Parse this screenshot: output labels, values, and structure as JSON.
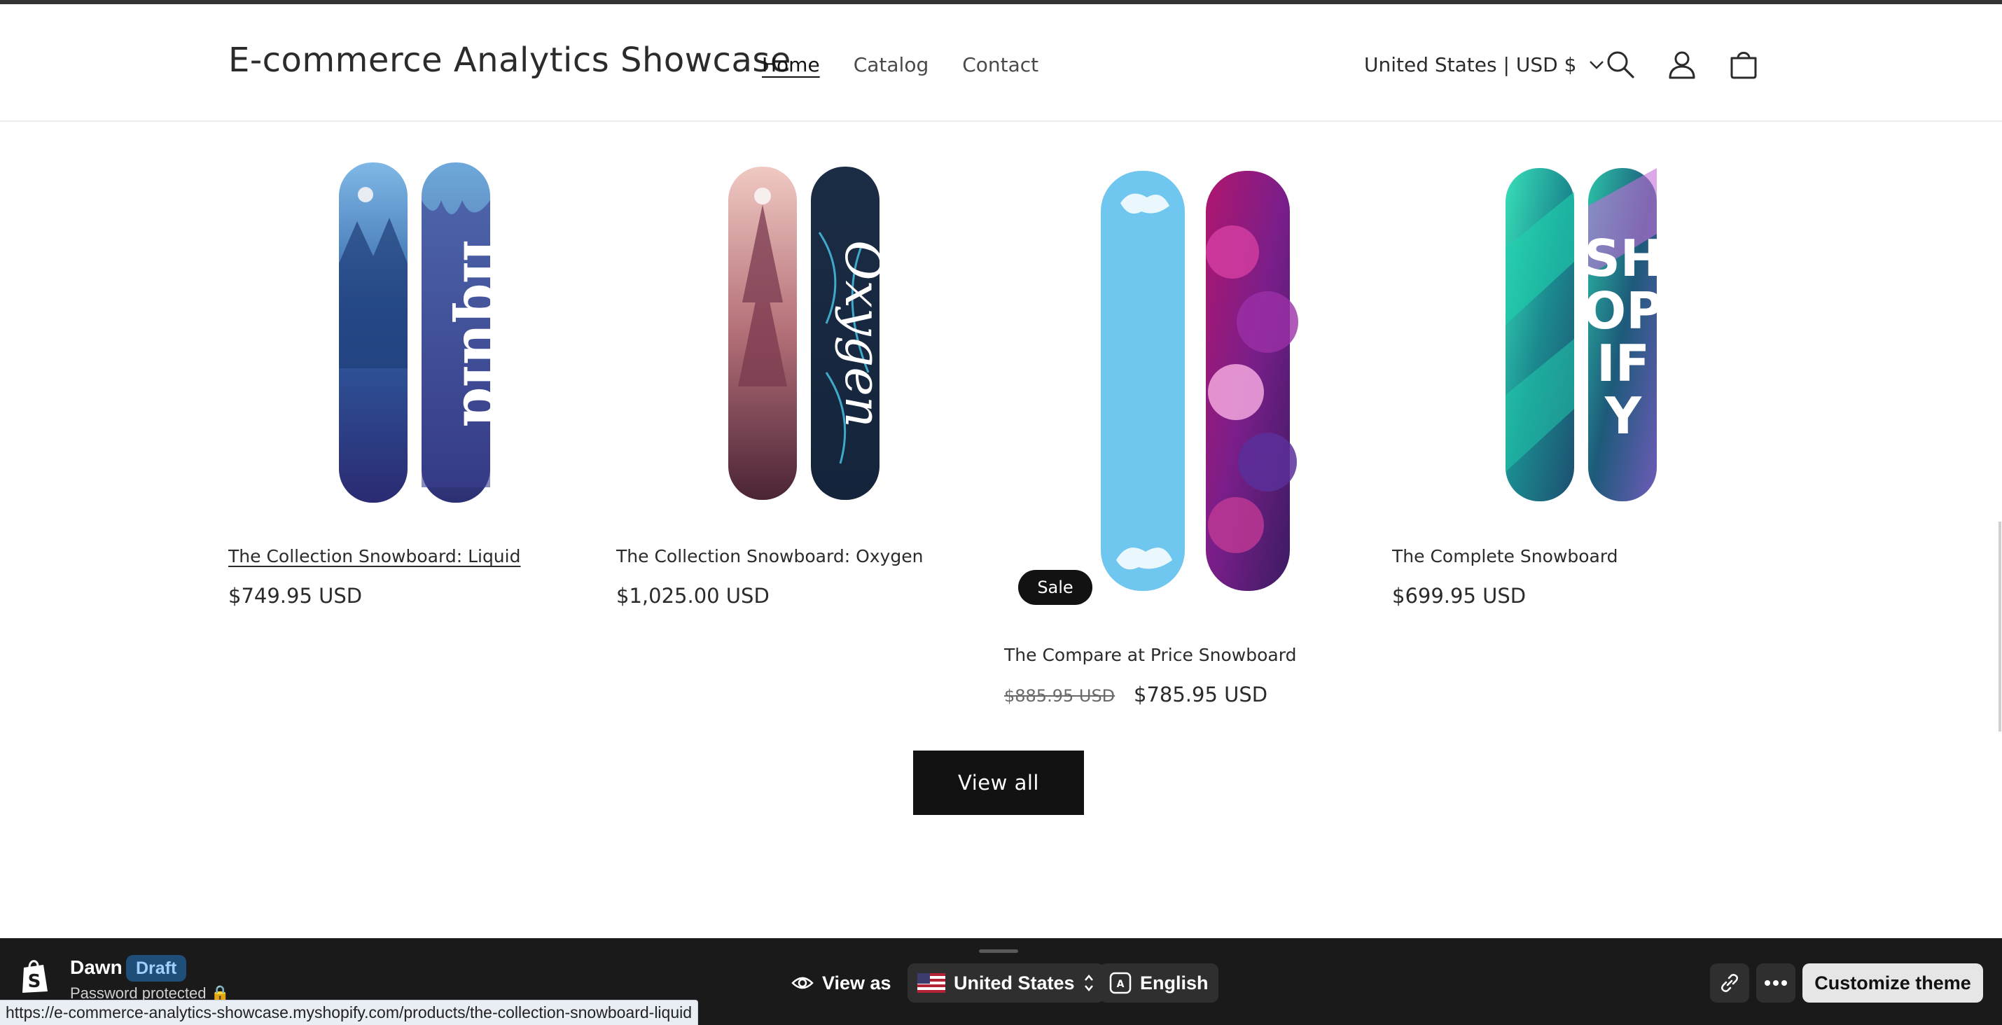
{
  "header": {
    "logo": "E-commerce Analytics Showcase",
    "nav": [
      {
        "label": "Home",
        "active": true
      },
      {
        "label": "Catalog",
        "active": false
      },
      {
        "label": "Contact",
        "active": false
      }
    ],
    "locale": "United States | USD $",
    "icons": [
      "search-icon",
      "account-icon",
      "cart-icon"
    ]
  },
  "products": [
    {
      "title": "The Collection Snowboard: Liquid",
      "price": "$749.95 USD",
      "art": "liquid"
    },
    {
      "title": "The Collection Snowboard: Oxygen",
      "price": "$1,025.00 USD",
      "art": "oxygen"
    },
    {
      "title": "The Compare at Price Snowboard",
      "compare_price": "$885.95 USD",
      "price": "$785.95 USD",
      "badge": "Sale",
      "art": "compare"
    },
    {
      "title": "The Complete Snowboard",
      "price": "$699.95 USD",
      "art": "shopify"
    }
  ],
  "view_all_label": "View all",
  "preview_bar": {
    "theme_name": "Dawn",
    "theme_status": "Draft",
    "password_label": "Password protected",
    "view_as_label": "View as",
    "country": "United States",
    "language": "English",
    "customize_label": "Customize theme"
  },
  "status_url": "https://e-commerce-analytics-showcase.myshopify.com/products/the-collection-snowboard-liquid",
  "colors": {
    "button_bg": "#121212",
    "preview_bar_bg": "#1a1a1a",
    "draft_badge": "#1f4e79"
  }
}
